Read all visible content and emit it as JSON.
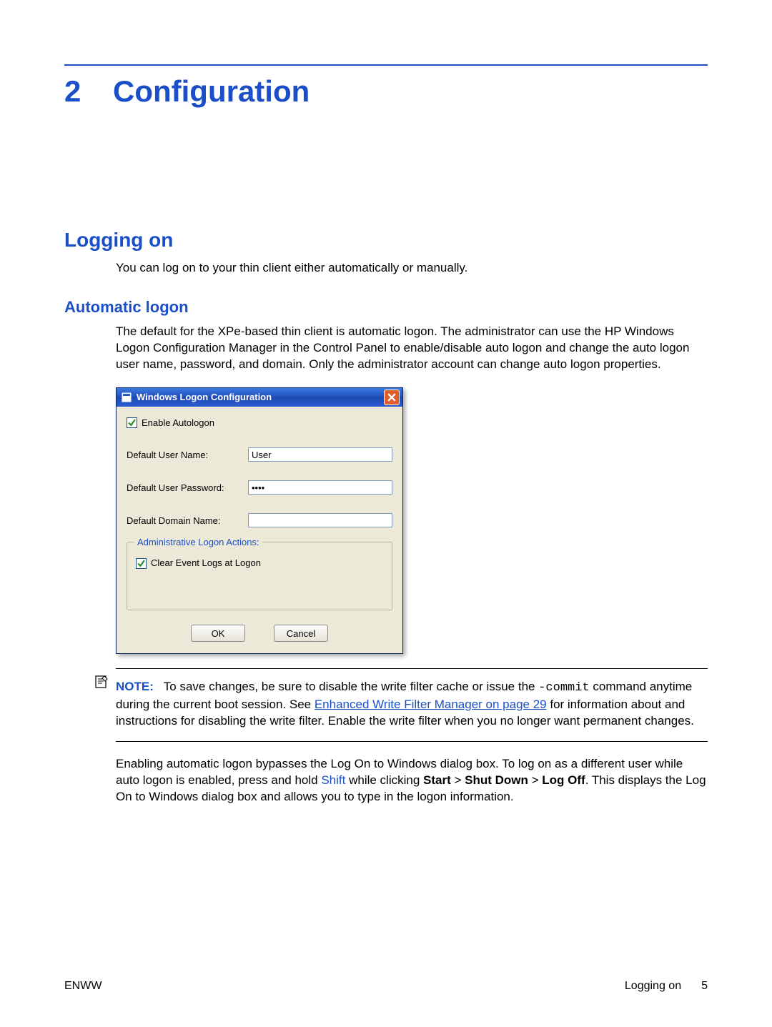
{
  "chapter": {
    "number": "2",
    "title": "Configuration"
  },
  "section": {
    "h2": "Logging on",
    "intro": "You can log on to your thin client either automatically or manually."
  },
  "subsection": {
    "h3": "Automatic logon",
    "body": "The default for the XPe-based thin client is automatic logon. The administrator can use the HP Windows Logon Configuration Manager in the Control Panel to enable/disable auto logon and change the auto logon user name, password, and domain. Only the administrator account can change auto logon properties."
  },
  "dialog": {
    "title": "Windows Logon Configuration",
    "enable_autologon_label": "Enable Autologon",
    "enable_autologon_checked": true,
    "rows": {
      "username_label": "Default User Name:",
      "username_value": "User",
      "password_label": "Default User Password:",
      "password_value": "••••",
      "domain_label": "Default Domain Name:",
      "domain_value": ""
    },
    "fieldset": {
      "legend": "Administrative Logon Actions:",
      "clear_logs_label": "Clear Event Logs at Logon",
      "clear_logs_checked": true
    },
    "buttons": {
      "ok": "OK",
      "cancel": "Cancel"
    }
  },
  "note": {
    "label": "NOTE:",
    "part1": "To save changes, be sure to disable the write filter cache or issue the ",
    "code": "-commit",
    "part2": " command anytime during the current boot session. See ",
    "link_text": "Enhanced Write Filter Manager on page 29",
    "part3": " for information about and instructions for disabling the write filter. Enable the write filter when you no longer want permanent changes."
  },
  "para2": {
    "a": "Enabling automatic logon bypasses the Log On to Windows dialog box. To log on as a different user while auto logon is enabled, press and hold ",
    "shift": "Shift",
    "b": " while clicking ",
    "start": "Start",
    "gt1": " > ",
    "shutdown": "Shut Down",
    "gt2": " > ",
    "logoff": "Log Off",
    "c": ". This displays the Log On to Windows dialog box and allows you to type in the logon information."
  },
  "footer": {
    "left": "ENWW",
    "section": "Logging on",
    "page": "5"
  }
}
